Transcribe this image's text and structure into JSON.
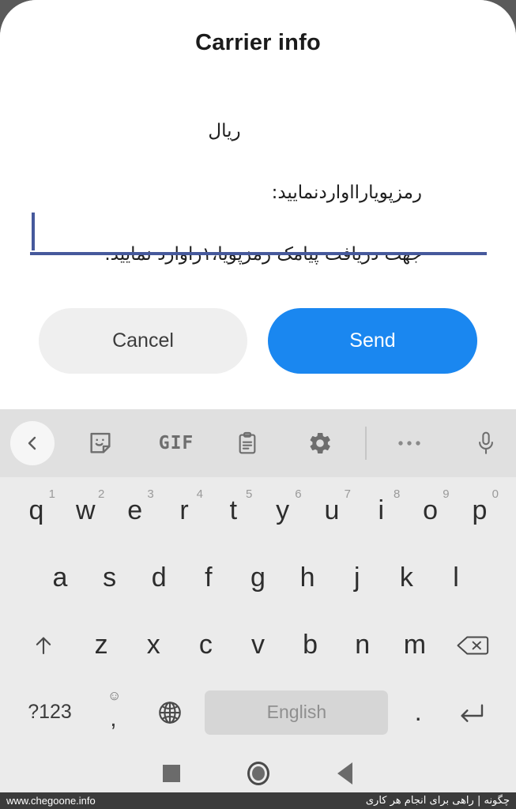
{
  "dialog": {
    "title": "Carrier info",
    "message_lines": [
      "ریال",
      "رمزپویارااواردنمایید:",
      "جهت دریافت پیامک رمزپویا،۱راوارد نمایید."
    ],
    "input": {
      "value": "",
      "placeholder": ""
    },
    "buttons": {
      "cancel": "Cancel",
      "send": "Send"
    },
    "accent_color": "#1a87f0",
    "underline_color": "#46599c",
    "cancel_bg": "#efefef"
  },
  "keyboard": {
    "toolbar": {
      "back": "back-chevron",
      "sticker": "sticker-smiley",
      "gif": "GIF",
      "clipboard": "clipboard",
      "settings": "gear",
      "more": "three-dots",
      "mic": "microphone"
    },
    "row1": [
      {
        "key": "q",
        "num": "1"
      },
      {
        "key": "w",
        "num": "2"
      },
      {
        "key": "e",
        "num": "3"
      },
      {
        "key": "r",
        "num": "4"
      },
      {
        "key": "t",
        "num": "5"
      },
      {
        "key": "y",
        "num": "6"
      },
      {
        "key": "u",
        "num": "7"
      },
      {
        "key": "i",
        "num": "8"
      },
      {
        "key": "o",
        "num": "9"
      },
      {
        "key": "p",
        "num": "0"
      }
    ],
    "row2": [
      "a",
      "s",
      "d",
      "f",
      "g",
      "h",
      "j",
      "k",
      "l"
    ],
    "row3": [
      "z",
      "x",
      "c",
      "v",
      "b",
      "n",
      "m"
    ],
    "row3_shift": "shift-up-arrow",
    "row3_delete": "backspace",
    "row4": {
      "symbols": "?123",
      "comma": ",",
      "emoji": "☺",
      "globe": "globe-language",
      "space_label": "English",
      "period": ".",
      "enter": "enter-return"
    },
    "bg_color": "#ebebeb",
    "toolbar_bg": "#e0e0e0",
    "space_key_bg": "#d6d6d6"
  },
  "navbar": {
    "recents": "square-recents",
    "home": "circle-home",
    "back": "triangle-back"
  },
  "footer": {
    "left": "www.chegoone.info",
    "right": "چگونه | راهی برای انجام هر کاری"
  }
}
